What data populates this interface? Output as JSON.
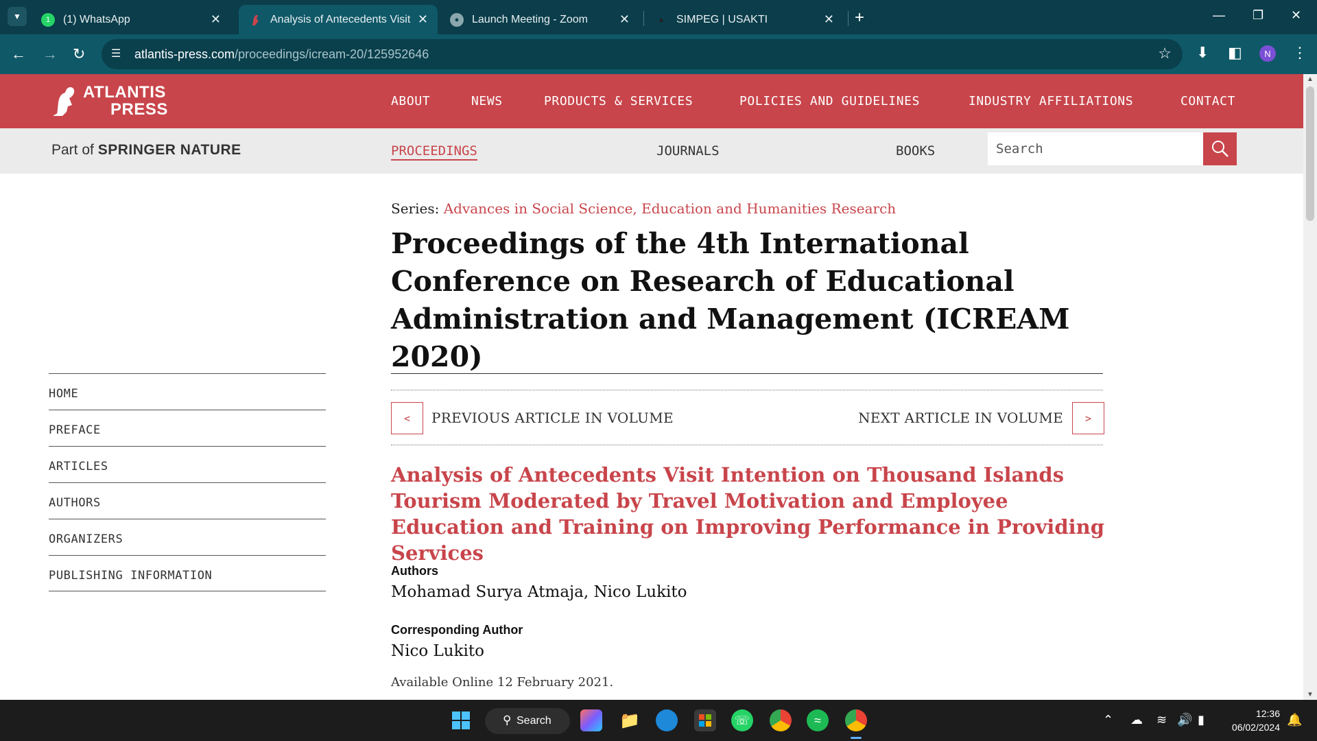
{
  "browser": {
    "tabs": [
      {
        "title": "(1) WhatsApp",
        "badge": "1"
      },
      {
        "title": "Analysis of Antecedents Visit Intention on Thousand Islands",
        "active": true
      },
      {
        "title": "Launch Meeting - Zoom"
      },
      {
        "title": "SIMPEG | USAKTI"
      }
    ],
    "url_host": "atlantis-press.com",
    "url_path": "/proceedings/icream-20/125952646",
    "profile_initial": "N"
  },
  "site": {
    "logo_line1": "ATLANTIS",
    "logo_line2": "PRESS",
    "nav": [
      "ABOUT",
      "NEWS",
      "PRODUCTS & SERVICES",
      "POLICIES AND GUIDELINES",
      "INDUSTRY AFFILIATIONS",
      "CONTACT"
    ],
    "part_of": "Part of",
    "springer": "SPRINGER NATURE",
    "subnav": [
      "PROCEEDINGS",
      "JOURNALS",
      "BOOKS"
    ],
    "search_placeholder": "Search"
  },
  "sidebar": [
    "HOME",
    "PREFACE",
    "ARTICLES",
    "AUTHORS",
    "ORGANIZERS",
    "PUBLISHING INFORMATION"
  ],
  "content": {
    "series_label": "Series:",
    "series_name": "Advances in Social Science, Education and Humanities Research",
    "proceedings_title": "Proceedings of the 4th International Conference on Research of Educational Administration and Management (ICREAM 2020)",
    "prev_label": "PREVIOUS ARTICLE IN VOLUME",
    "next_label": "NEXT ARTICLE IN VOLUME",
    "prev_symbol": "<",
    "next_symbol": ">",
    "article_title": "Analysis of Antecedents Visit Intention on Thousand Islands Tourism Moderated by Travel Motivation and Employee Education and Training on Improving Performance in Providing Services",
    "authors_label": "Authors",
    "authors": "Mohamad Surya Atmaja, Nico Lukito",
    "corresponding_label": "Corresponding Author",
    "corresponding": "Nico Lukito",
    "available": "Available Online 12 February 2021."
  },
  "taskbar": {
    "search_label": "Search",
    "time": "12:36",
    "date": "06/02/2024"
  },
  "colors": {
    "brand_red": "#c8454b",
    "chrome_dark": "#0b3d4a",
    "chrome_mid": "#0f5867"
  }
}
